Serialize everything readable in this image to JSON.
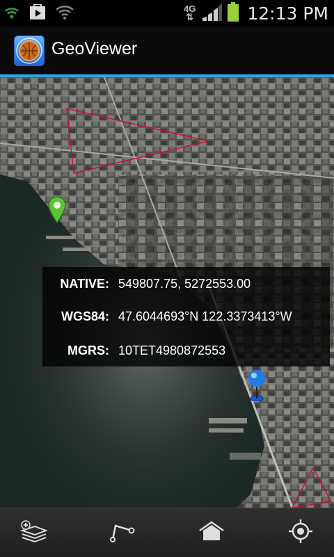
{
  "status_bar": {
    "network": "4G",
    "time": "12:13 PM",
    "icons": [
      "signal-wifi-icon",
      "play-store-icon",
      "wifi-icon",
      "cellular-signal-icon",
      "battery-icon"
    ]
  },
  "app": {
    "title": "GeoViewer",
    "icon": "geoviewer-app-icon"
  },
  "map": {
    "markers": [
      "green-location-pin-icon",
      "blue-location-pin-icon"
    ],
    "overlays": [
      "red-triangle-polygon",
      "red-triangle-polygon-lower"
    ]
  },
  "coordinates": {
    "rows": [
      {
        "label": "NATIVE:",
        "value": "549807.75, 5272553.00"
      },
      {
        "label": "WGS84:",
        "value": "47.6044693°N 122.3373413°W"
      },
      {
        "label": "MGRS:",
        "value": "10TET4980872553"
      }
    ]
  },
  "toolbar": {
    "buttons": [
      "add-layer-icon",
      "sketch-icon",
      "home-icon",
      "locate-icon"
    ]
  },
  "colors": {
    "accent": "#33a6e0",
    "overlay_line": "#c8102e"
  }
}
